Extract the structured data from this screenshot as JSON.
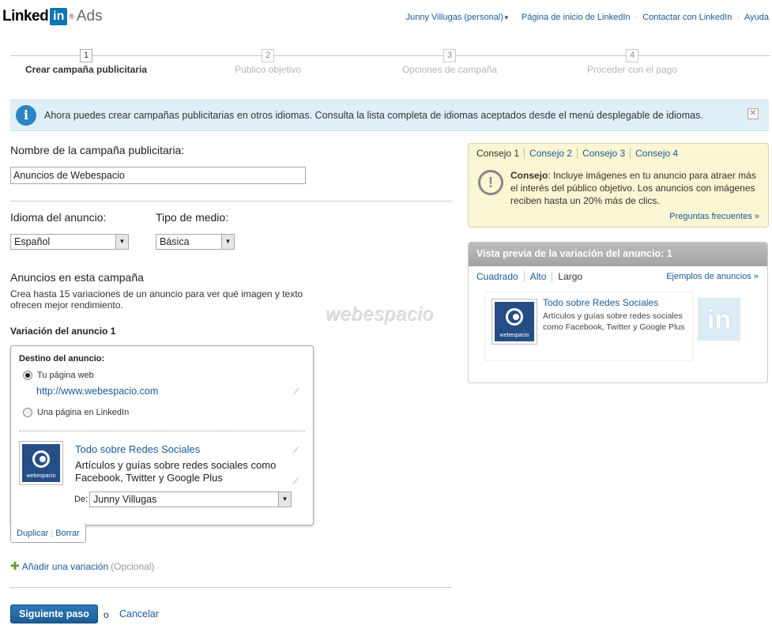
{
  "header": {
    "logo_word": "Linked",
    "logo_in": "in",
    "logo_reg": "®",
    "logo_ads": "Ads",
    "nav": {
      "user": "Junny Villugas (personal)",
      "home": "Página de inicio de LinkedIn",
      "contact": "Contactar con LinkedIn",
      "help": "Ayuda"
    }
  },
  "steps": [
    {
      "num": "1",
      "label": "Crear campaña publicitaria"
    },
    {
      "num": "2",
      "label": "Público objetivo"
    },
    {
      "num": "3",
      "label": "Opciones de campaña"
    },
    {
      "num": "4",
      "label": "Proceder con el pago"
    }
  ],
  "banner": {
    "text": "Ahora puedes crear campañas publicitarias en otros idiomas. Consulta la lista completa de idiomas aceptados desde el menú desplegable de idiomas.",
    "info_glyph": "i",
    "close_glyph": "✕"
  },
  "form": {
    "campaign_name_label": "Nombre de la campaña publicitaria:",
    "campaign_name_value": "Anuncios de Webespacio",
    "language_label": "Idioma del anuncio:",
    "language_value": "Español",
    "media_label": "Tipo de medio:",
    "media_value": "Básica",
    "ads_heading": "Anuncios en esta campaña",
    "ads_desc": "Crea hasta 15 variaciones de un anuncio para ver qué imagen y texto ofrecen mejor rendimiento.",
    "variation_title": "Variación del anuncio 1",
    "destination_label": "Destino del anuncio:",
    "option_web": "Tu página web",
    "url_value": "http://www.webespacio.com",
    "option_linkedin": "Una página en LinkedIn",
    "ad_title": "Todo sobre Redes Sociales",
    "ad_body": "Artículos y guías sobre redes sociales como Facebook, Twitter y Google Plus",
    "from_label": "De:",
    "from_value": "Junny Villugas",
    "image_caption": "webespacio",
    "duplicate": "Duplicar",
    "delete": "Borrar",
    "add_variation": "Añadir una variación",
    "optional": "(Opcional)",
    "next_button": "Siguiente paso",
    "or": "o",
    "cancel": "Cancelar"
  },
  "tips": {
    "tabs": [
      "Consejo 1",
      "Consejo 2",
      "Consejo 3",
      "Consejo 4"
    ],
    "strong": "Consejo",
    "text": ": Incluye imágenes en tu anuncio para atraer más el interés del público objetivo. Los anuncios con imágenes reciben hasta un 20% más de clics.",
    "faq": "Preguntas frecuentes »"
  },
  "preview": {
    "title": "Vista previa de la variación del anuncio: 1",
    "sizes": [
      "Cuadrado",
      "Alto",
      "Largo"
    ],
    "examples": "Ejemplos de anuncios »",
    "ad_title": "Todo sobre Redes Sociales",
    "ad_body": "Artículos y guías sobre redes sociales como Facebook, Twitter y Google Plus",
    "image_caption": "webespacio",
    "side_logo": "in"
  },
  "watermark": "webespacio",
  "colors": {
    "link": "#1a5a96",
    "brand_blue": "#0b76b4",
    "banner_bg": "#dfeff8",
    "tips_bg": "#faf5d2"
  }
}
